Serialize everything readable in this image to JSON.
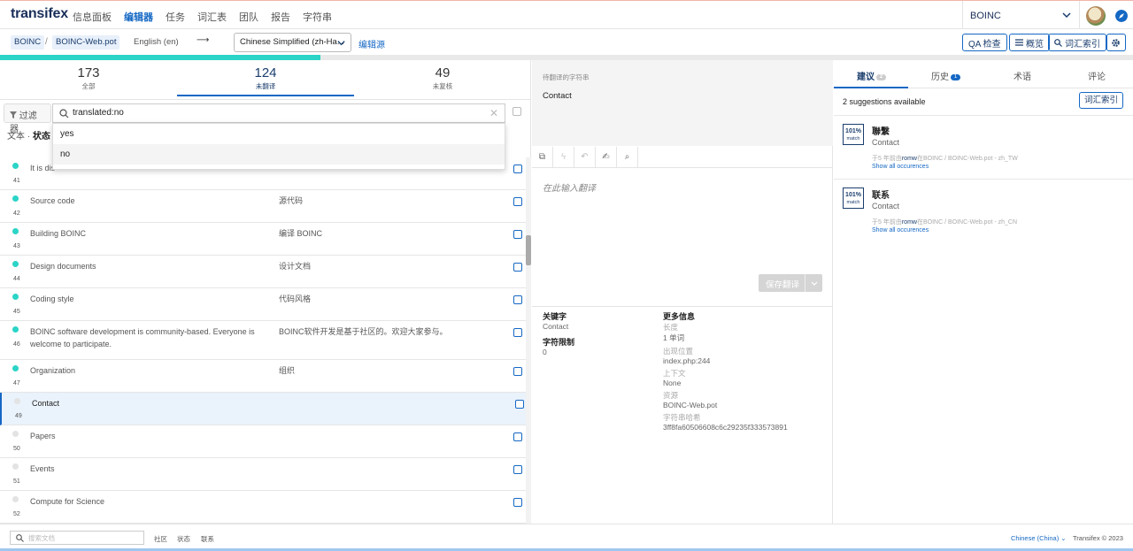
{
  "topnav": {
    "logo": "transifex",
    "links": [
      "信息面板",
      "编辑器",
      "任务",
      "词汇表",
      "团队",
      "报告",
      "字符串"
    ],
    "active_link": "编辑器",
    "project": "BOINC"
  },
  "subbar": {
    "breadcrumb": [
      "BOINC",
      "BOINC-Web.pot"
    ],
    "separator": "/",
    "source_language": "English (en)",
    "arrow": "⟶",
    "target_language": "Chinese Simplified (zh-Ha...",
    "edit_source": "编辑源",
    "buttons": {
      "qa": "QA 检查",
      "overview": "概览",
      "glossary": "词汇索引"
    },
    "progress_fraction": 0.283
  },
  "stats": [
    {
      "num": "173",
      "label": "全部"
    },
    {
      "num": "124",
      "label": "未翻译"
    },
    {
      "num": "49",
      "label": "未复核"
    }
  ],
  "filter": {
    "button": "过滤器",
    "query": "translated:no",
    "tabs_text": "文本",
    "tabs_status": "状态",
    "options": [
      "yes",
      "no"
    ]
  },
  "rows": [
    {
      "idx": "41",
      "src": "It is dis",
      "tgt": "",
      "done": true
    },
    {
      "idx": "42",
      "src": "Source code",
      "tgt": "源代码",
      "done": true
    },
    {
      "idx": "43",
      "src": "Building BOINC",
      "tgt": "编译 BOINC",
      "done": true
    },
    {
      "idx": "44",
      "src": "Design documents",
      "tgt": "设计文档",
      "done": true
    },
    {
      "idx": "45",
      "src": "Coding style",
      "tgt": "代码风格",
      "done": true
    },
    {
      "idx": "46",
      "src": "BOINC software development is community-based.  Everyone is welcome to participate.",
      "tgt": "BOINC软件开发是基于社区的。欢迎大家参与。",
      "done": true
    },
    {
      "idx": "47",
      "src": "Organization",
      "tgt": "组织",
      "done": true
    },
    {
      "idx": "49",
      "src": "Contact",
      "tgt": "",
      "done": false,
      "selected": true
    },
    {
      "idx": "50",
      "src": "Papers",
      "tgt": "",
      "done": false
    },
    {
      "idx": "51",
      "src": "Events",
      "tgt": "",
      "done": false
    },
    {
      "idx": "52",
      "src": "Compute for Science",
      "tgt": "",
      "done": false
    }
  ],
  "middle": {
    "caption": "待翻译的字符串",
    "source_text": "Contact",
    "placeholder": "在此输入翻译",
    "save": "保存翻译",
    "key_h": "关键字",
    "key_v": "Contact",
    "limit_h": "字符限制",
    "limit_v": "0",
    "more_h": "更多信息",
    "info": [
      {
        "k": "长度",
        "v": "1 单词"
      },
      {
        "k": "出现位置",
        "v": "index.php:244"
      },
      {
        "k": "上下文",
        "v": "None"
      },
      {
        "k": "资源",
        "v": "BOINC-Web.pot"
      },
      {
        "k": "字符串哈希",
        "v": "3ff8fa60506608c6c29235f333573891"
      }
    ]
  },
  "right": {
    "tabs": [
      "建议",
      "历史",
      "术语",
      "评论"
    ],
    "tab_badges": [
      "2",
      "1"
    ],
    "available": "2 suggestions available",
    "glossary_btn": "词汇索引",
    "suggestions": [
      {
        "match": "101%",
        "match2": "match",
        "tr": "聯繫",
        "src": "Contact",
        "meta_pre": "于5 年前由",
        "user": "romw",
        "meta_post": "在BOINC / BOINC-Web.pot - zh_TW",
        "occ": "Show all occurences"
      },
      {
        "match": "101%",
        "match2": "match",
        "tr": "联系",
        "src": "Contact",
        "meta_pre": "于5 年前由",
        "user": "romw",
        "meta_post": "在BOINC / BOINC-Web.pot - zh_CN",
        "occ": "Show all occurences"
      }
    ]
  },
  "footer": {
    "search_placeholder": "搜索文档",
    "links": [
      "社区",
      "状态",
      "联系"
    ],
    "lang": "Chinese (China)",
    "copyright": "Transifex © 2023"
  },
  "colors": {
    "accent": "#1568c4",
    "progress": "#2bd4c6",
    "navy": "#1a3d6d"
  }
}
